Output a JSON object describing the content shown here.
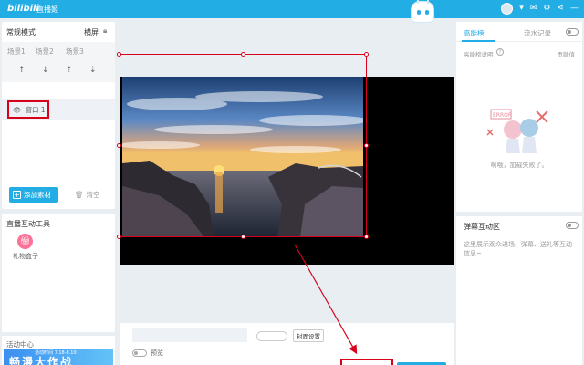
{
  "titlebar": {
    "logo": "bilibili",
    "app_name": "直播姬"
  },
  "scene_panel": {
    "title": "常规模式",
    "orientation": "横屏",
    "tabs": [
      "场景1",
      "场景2",
      "场景3"
    ],
    "source_name": "窗口 1",
    "add_source_label": "添加素材",
    "clear_label": "清空"
  },
  "tools_panel": {
    "title": "直播互动工具",
    "gift_box_label": "礼物盒子"
  },
  "activity_panel": {
    "title": "活动中心",
    "banner_small": "活动时间 7.18-8.10",
    "banner_text": "畅漫大作战"
  },
  "bottom_panel": {
    "cover_settings_label": "封面设置",
    "preview_label": "预览"
  },
  "right_panel": {
    "tabs": [
      "高能榜",
      "流水记录"
    ],
    "sub_label": "高能榜说明",
    "contributor_label": "贡献值",
    "error_text": "啊哦，加载失败了。"
  },
  "danmu_panel": {
    "title": "弹幕互动区",
    "description": "这里展示观众进场、弹幕、送礼等互动信息~"
  },
  "colors": {
    "accent": "#23ade5",
    "highlight": "#d9001b"
  }
}
